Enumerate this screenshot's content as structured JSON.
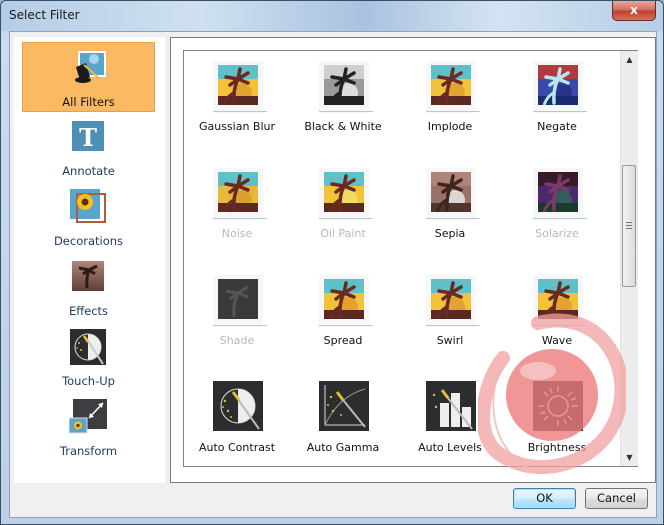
{
  "window": {
    "title": "Select Filter",
    "close_glyph": "x"
  },
  "sidebar": {
    "items": [
      {
        "label": "All Filters",
        "icon": "magic-hat-icon",
        "selected": true
      },
      {
        "label": "Annotate",
        "icon": "text-t-icon",
        "selected": false
      },
      {
        "label": "Decorations",
        "icon": "sunflower-frame-icon",
        "selected": false
      },
      {
        "label": "Effects",
        "icon": "palm-sepia-icon",
        "selected": false
      },
      {
        "label": "Touch-Up",
        "icon": "magic-wand-contrast-icon",
        "selected": false
      },
      {
        "label": "Transform",
        "icon": "resize-arrow-icon",
        "selected": false
      }
    ]
  },
  "filters": [
    {
      "label": "Gaussian Blur",
      "enabled": true
    },
    {
      "label": "Black & White",
      "enabled": true
    },
    {
      "label": "Implode",
      "enabled": true
    },
    {
      "label": "Negate",
      "enabled": true
    },
    {
      "label": "Noise",
      "enabled": false
    },
    {
      "label": "Oil Paint",
      "enabled": false
    },
    {
      "label": "Sepia",
      "enabled": true
    },
    {
      "label": "Solarize",
      "enabled": false
    },
    {
      "label": "Shade",
      "enabled": false
    },
    {
      "label": "Spread",
      "enabled": true
    },
    {
      "label": "Swirl",
      "enabled": true
    },
    {
      "label": "Wave",
      "enabled": true
    },
    {
      "label": "Auto Contrast",
      "enabled": true
    },
    {
      "label": "Auto Gamma",
      "enabled": true
    },
    {
      "label": "Auto Levels",
      "enabled": true
    },
    {
      "label": "Brightness",
      "enabled": true
    }
  ],
  "scrollbar": {
    "up_glyph": "▲",
    "down_glyph": "▼"
  },
  "buttons": {
    "ok": "OK",
    "cancel": "Cancel"
  },
  "colors": {
    "selected_category": "#fbb964",
    "disabled_text": "#b8b8b8",
    "click_indicator": "#f08080"
  }
}
